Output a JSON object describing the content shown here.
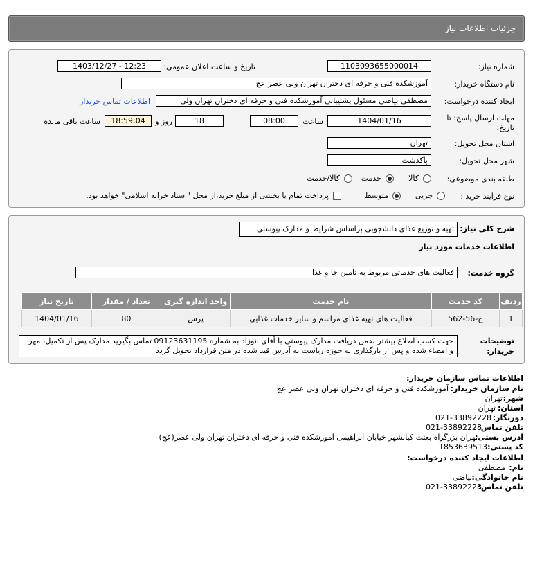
{
  "header": {
    "title": "جزئیات اطلاعات نیاز"
  },
  "form": {
    "need_number_label": "شماره نیاز:",
    "need_number": "1103093655000014",
    "announce_label": "تاریخ و ساعت اعلان عمومی:",
    "announce_value": "1403/12/27 - 12:23",
    "buyer_org_label": "نام دستگاه خریدار:",
    "buyer_org": "آموزشکده فنی و حرفه ای دختران تهران ولی عصر عج",
    "creator_label": "ایجاد کننده درخواست:",
    "creator": "مصطفی بیاضی مسئول پشتیبانی آموزشکده فنی و حرفه ای دختران تهران ولی",
    "contact_link": "اطلاعات تماس خریدار",
    "deadline_label_1": "مهلت ارسال پاسخ: تا",
    "deadline_label_2": "تاریخ:",
    "deadline_date": "1404/01/16",
    "time_label": "ساعت",
    "deadline_time": "08:00",
    "days_value": "18",
    "days_label": "روز و",
    "remaining_time": "18:59:04",
    "remaining_label": "ساعت باقی مانده",
    "province_label": "استان محل تحویل:",
    "province": "تهران",
    "city_label": "شهر محل تحویل:",
    "city": "پاکدشت",
    "category_label": "طبقه بندی موضوعی:",
    "category_options": [
      "کالا",
      "خدمت",
      "کالا/خدمت"
    ],
    "purchase_label": "نوع فرآیند خرید :",
    "purchase_options": [
      "جزیی",
      "متوسط"
    ],
    "treasury_text": "پرداخت تمام یا بخشی از مبلغ خرید،از محل \"اسناد خزانه اسلامی\" خواهد بود."
  },
  "details": {
    "summary_label": "شرح کلی نیاز:",
    "summary": "تهیه و توزیع غذای دانشجویی براساس شرایط و مدارک پیوستی",
    "services_title": "اطلاعات خدمات مورد نیاز",
    "group_label": "گروه خدمت:",
    "group_value": "فعالیت های خدماتی مربوط به تامین جا و غذا",
    "table_headers": [
      "ردیف",
      "کد خدمت",
      "نام خدمت",
      "واحد اندازه گیری",
      "تعداد / مقدار",
      "تاریخ نیاز"
    ],
    "rows": [
      [
        "1",
        "خ-56-562",
        "فعالیت های تهیه غذای مراسم و سایر خدمات غذایی",
        "پرس",
        "80",
        "1404/01/16"
      ]
    ],
    "notes_label_1": "توضیحات",
    "notes_label_2": "خریدار:",
    "notes": "جهت کسب اطلاع بیشتر ضمن دریافت مدارک پیوستی با آقای انوزاد به شماره 09123631195 تماس بگیرید مدارک پس از تکمیل، مهر و امضاء شده و پس از بارگذاری به حوزه ریاست به آدرس قید شده در متن قرارداد تحویل گردد"
  },
  "contact": {
    "buyer_section_title": "اطلاعات تماس سازمان خریدار:",
    "org_label": "نام سازمان خریدار:",
    "org_value": "آموزشکده فنی و حرفه ای دختران تهران ولی عصر عج",
    "city_label": "شهر:",
    "city_value": "تهران",
    "province_label": "استان:",
    "province_value": "تهران",
    "fax_label": "دورنگار:",
    "fax_value": "021-33892228",
    "phone_label": "تلفن تماس:",
    "phone_value": "021-33892228",
    "address_label": "آدرس پستی:",
    "address_value": "تهران بزرگراه بعثت کیانشهر خیابان ابراهیمی آموزشکده فنی و حرفه ای دختران تهران ولی عصر(عج)",
    "postal_label": "کد پستی:",
    "postal_value": "1853639513",
    "creator_section_title": "اطلاعات ایجاد کننده درخواست:",
    "name_label": "نام:",
    "name_value": "مصطفی",
    "family_label": "نام خانوادگی:",
    "family_value": "بیاضی",
    "creator_phone_label": "تلفن تماس:",
    "creator_phone_value": "021-33892228"
  }
}
